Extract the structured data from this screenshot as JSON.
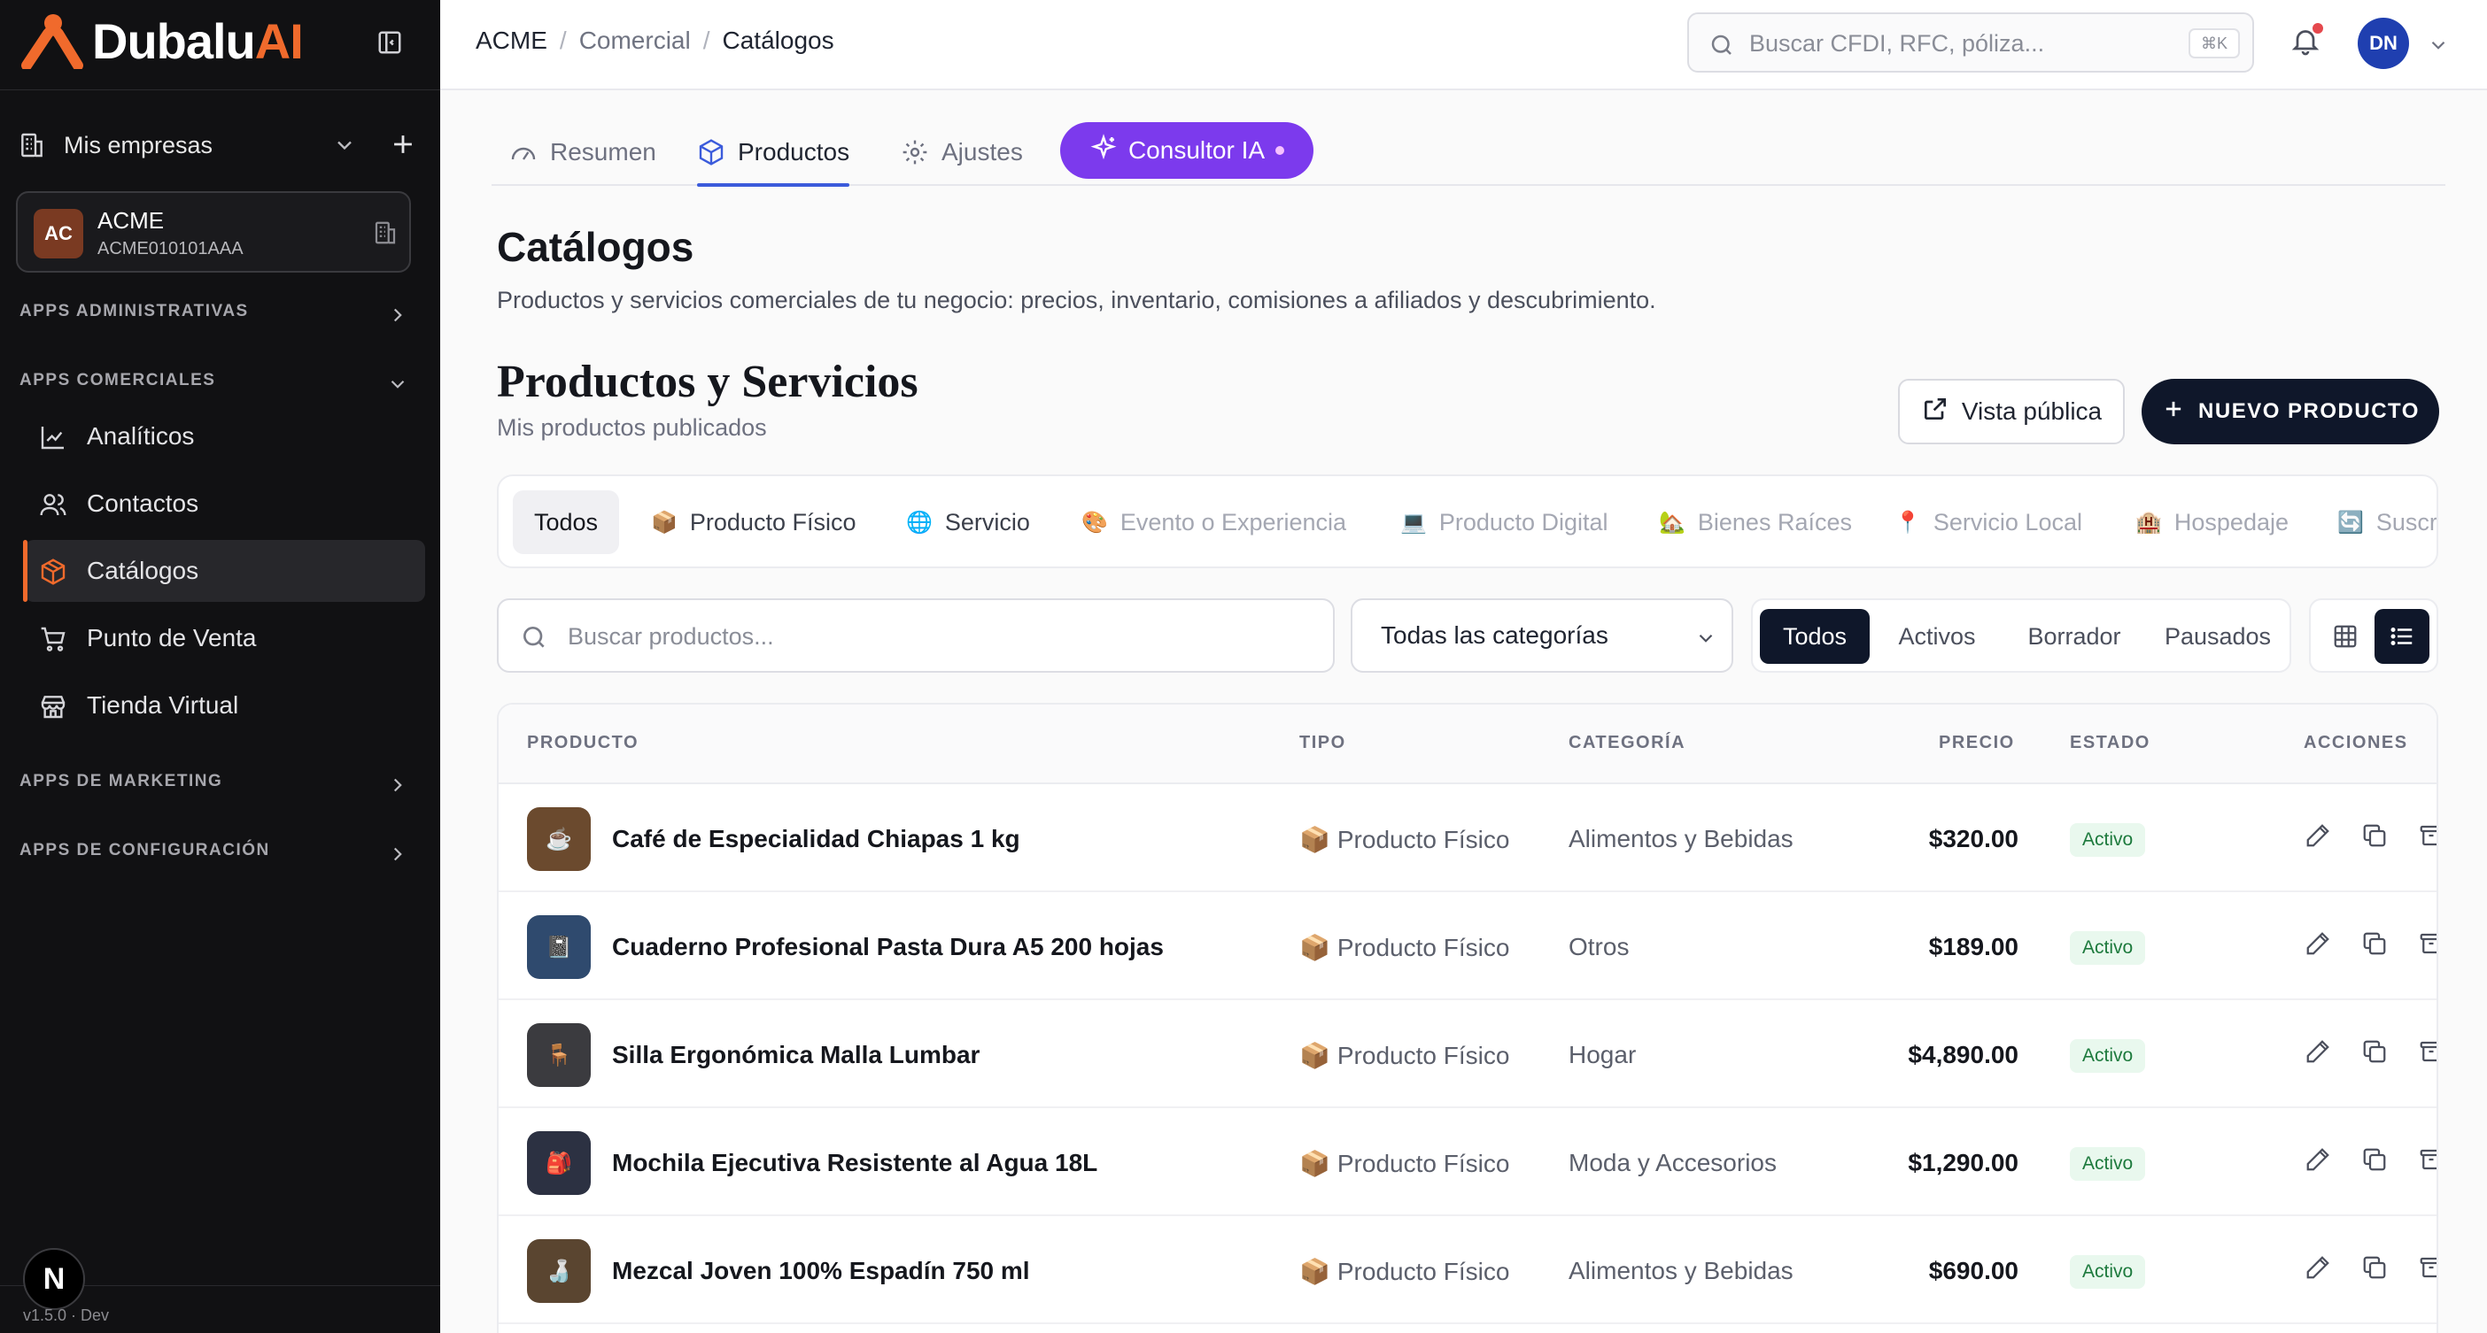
{
  "brand": {
    "name_main": "Dubalu",
    "name_accent": "AI",
    "accent_color": "#f06a2c"
  },
  "sidebar": {
    "companies_label": "Mis empresas",
    "company": {
      "initials": "AC",
      "name": "ACME",
      "rfc": "ACME010101AAA"
    },
    "sections": [
      {
        "label": "APPS ADMINISTRATIVAS"
      },
      {
        "label": "APPS COMERCIALES"
      },
      {
        "label": "APPS DE MARKETING"
      },
      {
        "label": "APPS DE CONFIGURACIÓN"
      }
    ],
    "items": [
      {
        "label": "Analíticos",
        "icon": "chart-line-icon"
      },
      {
        "label": "Contactos",
        "icon": "users-icon"
      },
      {
        "label": "Catálogos",
        "icon": "box-icon"
      },
      {
        "label": "Punto de Venta",
        "icon": "cart-icon"
      },
      {
        "label": "Tienda Virtual",
        "icon": "store-icon"
      }
    ],
    "badge": "N",
    "version": "v1.5.0 · Dev"
  },
  "topbar": {
    "breadcrumb": [
      "ACME",
      "Comercial",
      "Catálogos"
    ],
    "breadcrumb_sep": "/",
    "search_placeholder": "Buscar CFDI, RFC, póliza...",
    "shortcut": "⌘K",
    "user_initials": "DN"
  },
  "tabs": [
    {
      "label": "Resumen",
      "icon": "gauge-icon"
    },
    {
      "label": "Productos",
      "icon": "cube-icon"
    },
    {
      "label": "Ajustes",
      "icon": "gear-icon"
    }
  ],
  "ai_tab": {
    "label": "Consultor IA",
    "color": "#7c3aed"
  },
  "page": {
    "title": "Catálogos",
    "description": "Productos y servicios comerciales de tu negocio: precios, inventario, comisiones a afiliados y descubrimiento.",
    "section_title": "Productos y Servicios",
    "section_subtitle": "Mis productos publicados",
    "public_view": "Vista pública",
    "new_product": "NUEVO PRODUCTO"
  },
  "types": [
    {
      "label": "Todos",
      "emoji": ""
    },
    {
      "label": "Producto Físico",
      "emoji": "📦"
    },
    {
      "label": "Servicio",
      "emoji": "🌐"
    },
    {
      "label": "Evento o Experiencia",
      "emoji": "🎨"
    },
    {
      "label": "Producto Digital",
      "emoji": "💻"
    },
    {
      "label": "Bienes Raíces",
      "emoji": "🏡"
    },
    {
      "label": "Servicio Local",
      "emoji": "📍"
    },
    {
      "label": "Hospedaje",
      "emoji": "🏨"
    },
    {
      "label": "Suscr",
      "emoji": "🔄"
    }
  ],
  "filters": {
    "search_placeholder": "Buscar productos...",
    "category": "Todas las categorías",
    "status": [
      "Todos",
      "Activos",
      "Borrador",
      "Pausados"
    ]
  },
  "table": {
    "headers": {
      "product": "PRODUCTO",
      "type": "TIPO",
      "category": "CATEGORÍA",
      "price": "PRECIO",
      "status": "ESTADO",
      "actions": "ACCIONES"
    },
    "rows": [
      {
        "thumb": "☕",
        "thumb_color": "#6b4a2e",
        "name": "Café de Especialidad Chiapas 1 kg",
        "type_emoji": "📦",
        "type": "Producto Físico",
        "category": "Alimentos y Bebidas",
        "price": "$320.00",
        "status": "Activo"
      },
      {
        "thumb": "📓",
        "thumb_color": "#2f4a6e",
        "name": "Cuaderno Profesional Pasta Dura A5 200 hojas",
        "type_emoji": "📦",
        "type": "Producto Físico",
        "category": "Otros",
        "price": "$189.00",
        "status": "Activo"
      },
      {
        "thumb": "🪑",
        "thumb_color": "#3b3b3f",
        "name": "Silla Ergonómica Malla Lumbar",
        "type_emoji": "📦",
        "type": "Producto Físico",
        "category": "Hogar",
        "price": "$4,890.00",
        "status": "Activo"
      },
      {
        "thumb": "🎒",
        "thumb_color": "#2c3142",
        "name": "Mochila Ejecutiva Resistente al Agua 18L",
        "type_emoji": "📦",
        "type": "Producto Físico",
        "category": "Moda y Accesorios",
        "price": "$1,290.00",
        "status": "Activo"
      },
      {
        "thumb": "🍶",
        "thumb_color": "#5a4530",
        "name": "Mezcal Joven 100% Espadín 750 ml",
        "type_emoji": "📦",
        "type": "Producto Físico",
        "category": "Alimentos y Bebidas",
        "price": "$690.00",
        "status": "Activo"
      }
    ]
  }
}
